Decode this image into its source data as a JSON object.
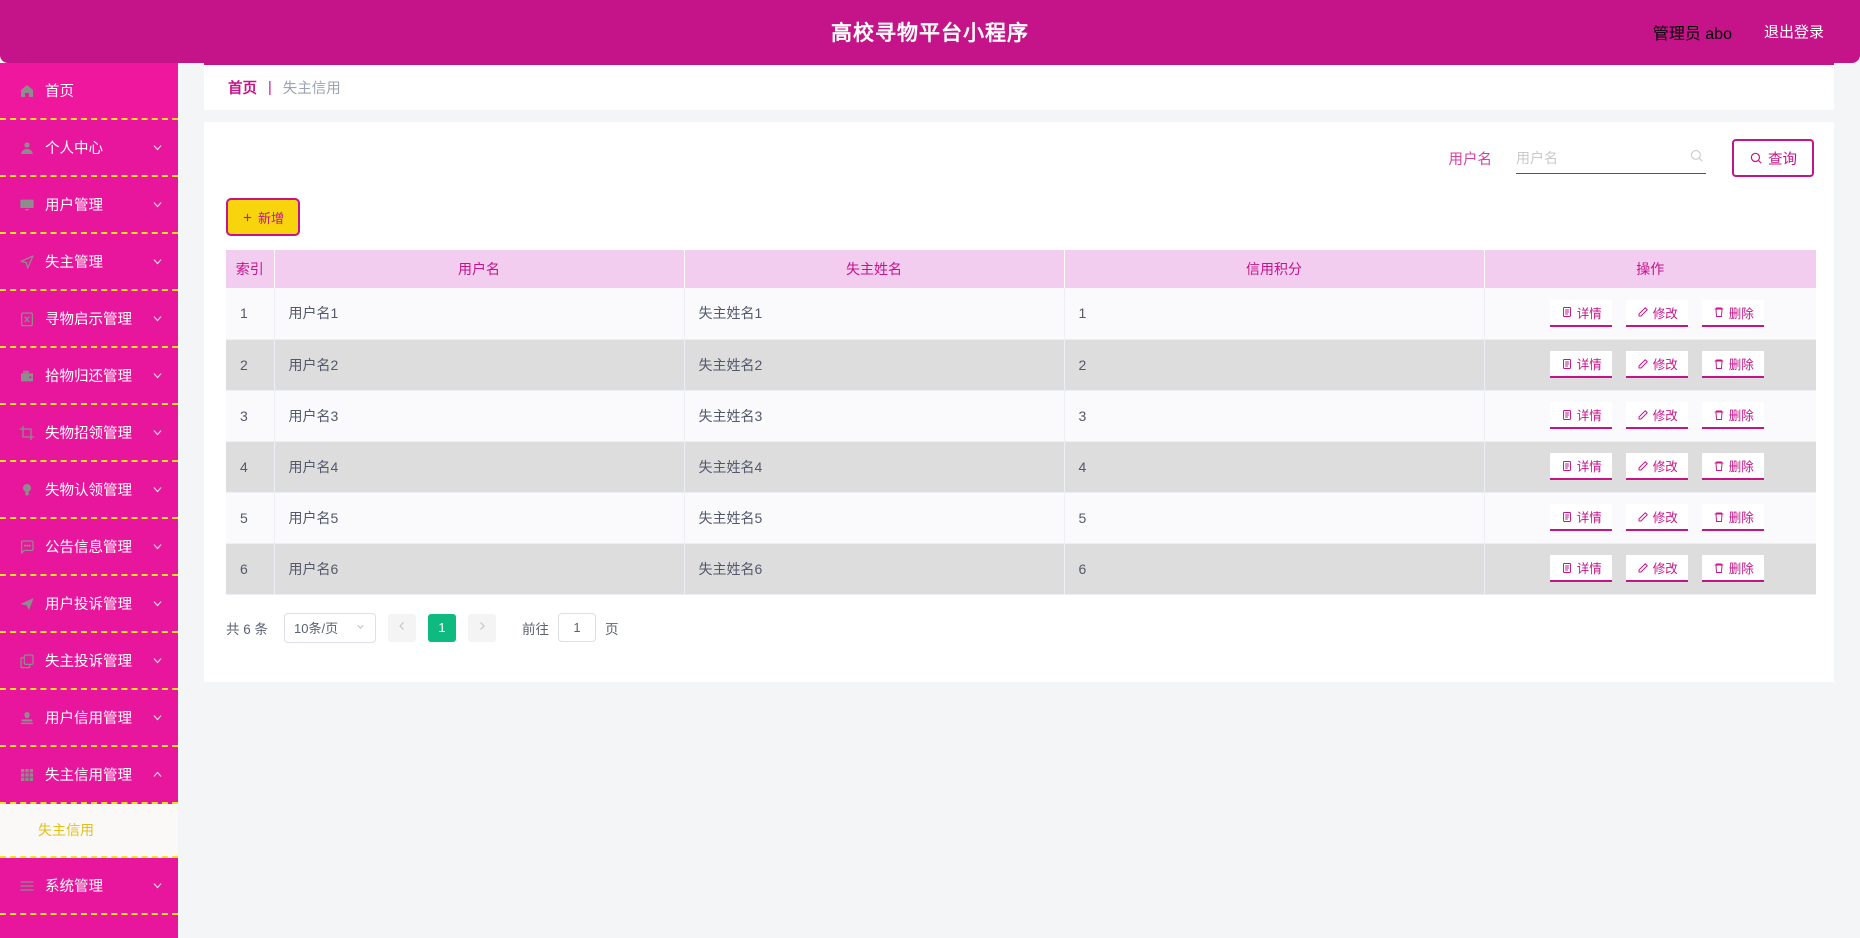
{
  "header": {
    "title": "高校寻物平台小程序",
    "user": "管理员 abo",
    "logout": "退出登录"
  },
  "sidebar": {
    "items": [
      {
        "label": "首页",
        "icon": "home-icon",
        "arrow": "",
        "active": true
      },
      {
        "label": "个人中心",
        "icon": "user-icon",
        "arrow": "chevron-down-icon"
      },
      {
        "label": "用户管理",
        "icon": "monitor-icon",
        "arrow": "chevron-down-icon"
      },
      {
        "label": "失主管理",
        "icon": "navigation-icon",
        "arrow": "chevron-down-icon"
      },
      {
        "label": "寻物启示管理",
        "icon": "clipboard-x-icon",
        "arrow": "chevron-down-icon"
      },
      {
        "label": "拾物归还管理",
        "icon": "wallet-icon",
        "arrow": "chevron-down-icon"
      },
      {
        "label": "失物招领管理",
        "icon": "crop-icon",
        "arrow": "chevron-down-icon"
      },
      {
        "label": "失物认领管理",
        "icon": "bulb-icon",
        "arrow": "chevron-down-icon"
      },
      {
        "label": "公告信息管理",
        "icon": "chat-icon",
        "arrow": "chevron-down-icon"
      },
      {
        "label": "用户投诉管理",
        "icon": "send-icon",
        "arrow": "chevron-down-icon"
      },
      {
        "label": "失主投诉管理",
        "icon": "copy-icon",
        "arrow": "chevron-down-icon"
      },
      {
        "label": "用户信用管理",
        "icon": "stamp-icon",
        "arrow": "chevron-down-icon"
      },
      {
        "label": "失主信用管理",
        "icon": "grid-icon",
        "arrow": "chevron-up-icon",
        "expanded": true
      }
    ],
    "submenu": {
      "label": "失主信用"
    },
    "after_submenu": [
      {
        "label": "系统管理",
        "icon": "list-icon",
        "arrow": "chevron-down-icon"
      }
    ]
  },
  "breadcrumb": {
    "home": "首页",
    "separator": "|",
    "current": "失主信用"
  },
  "search": {
    "label": "用户名",
    "placeholder": "用户名",
    "value": "",
    "button": "查询",
    "button_icon": "search-icon",
    "field_icon": "search-icon"
  },
  "toolbar": {
    "add_label": "新增",
    "add_icon": "plus-icon"
  },
  "table": {
    "columns": [
      "索引",
      "用户名",
      "失主姓名",
      "信用积分",
      "操作"
    ],
    "rows": [
      {
        "index": "1",
        "username": "用户名1",
        "owner": "失主姓名1",
        "score": "1"
      },
      {
        "index": "2",
        "username": "用户名2",
        "owner": "失主姓名2",
        "score": "2"
      },
      {
        "index": "3",
        "username": "用户名3",
        "owner": "失主姓名3",
        "score": "3"
      },
      {
        "index": "4",
        "username": "用户名4",
        "owner": "失主姓名4",
        "score": "4"
      },
      {
        "index": "5",
        "username": "用户名5",
        "owner": "失主姓名5",
        "score": "5"
      },
      {
        "index": "6",
        "username": "用户名6",
        "owner": "失主姓名6",
        "score": "6"
      }
    ],
    "ops": {
      "detail": "详情",
      "edit": "修改",
      "delete": "删除",
      "detail_icon": "document-icon",
      "edit_icon": "pencil-icon",
      "delete_icon": "trash-icon"
    }
  },
  "pagination": {
    "total_text": "共 6 条",
    "page_size": "10条/页",
    "prev_icon": "chevron-left-icon",
    "next_icon": "chevron-right-icon",
    "current_page": "1",
    "jump_prefix": "前往",
    "jump_value": "1",
    "jump_suffix": "页"
  },
  "colors": {
    "header": "#C5138A",
    "sidebar": "#E8169C",
    "dashed_border": "#F2E21B",
    "accent": "#C5138A",
    "add_button_bg": "#F7D40C",
    "table_header_bg": "#F3CDEF",
    "row_even_bg": "#DDDDDD",
    "row_odd_bg": "#FAFAFC",
    "pager_active": "#0FBA81",
    "submenu_text": "#E3C018"
  }
}
